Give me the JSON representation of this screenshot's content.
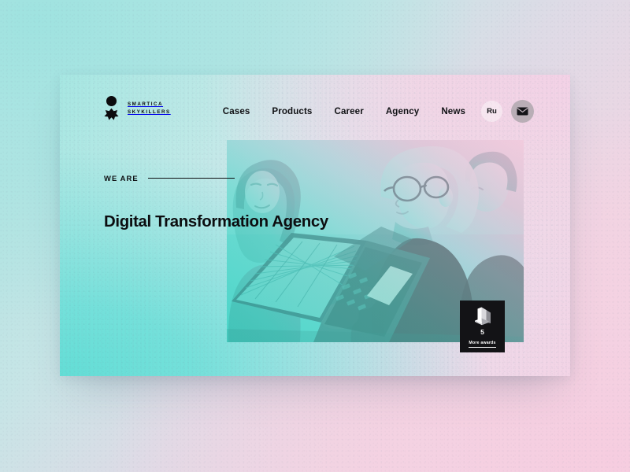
{
  "brand": {
    "line1": "SMARTICA",
    "line2": "SKYKILLERS",
    "logo_icon": "circle-cross-logo-icon"
  },
  "nav": {
    "items": [
      {
        "label": "Cases"
      },
      {
        "label": "Products"
      },
      {
        "label": "Career"
      },
      {
        "label": "Agency"
      },
      {
        "label": "News"
      }
    ],
    "language": "Ru",
    "mail_icon": "envelope-icon"
  },
  "hero": {
    "eyebrow": "WE ARE",
    "headline": "Digital Transformation Agency",
    "photo_alt": "three-colleagues-working-at-laptops"
  },
  "awards": {
    "icon": "award-trophy-icon",
    "count": "5",
    "label": "More awards"
  },
  "colors": {
    "ink": "#0c0d10",
    "badge_bg": "#131316",
    "teal": "#63ded6",
    "pink": "#f3d2e6",
    "mail_circle": "#b9aeb6"
  }
}
